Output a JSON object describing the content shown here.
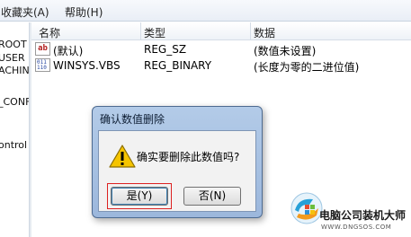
{
  "menubar": {
    "favorites": "收藏夹(A)",
    "help": "帮助(H)"
  },
  "tree": {
    "items": [
      "ROOT",
      "USER",
      "ACHIN",
      "_CONF",
      "ontrol"
    ]
  },
  "columns": {
    "name": "名称",
    "type": "类型",
    "data": "数据"
  },
  "rows": [
    {
      "icon": "string-value-icon",
      "icon_text": "ab",
      "name": "(默认)",
      "type": "REG_SZ",
      "data": "(数值未设置)"
    },
    {
      "icon": "binary-value-icon",
      "icon_text": "011 110",
      "name": "WINSYS.VBS",
      "type": "REG_BINARY",
      "data": "(长度为零的二进位值)"
    }
  ],
  "dialog": {
    "title": "确认数值删除",
    "message": "确实要删除此数值吗?",
    "yes_label": "是(Y)",
    "no_label": "否(N)",
    "icon": "warning-icon"
  },
  "watermark": {
    "title": "电脑公司装机大师",
    "url": "WWW.DNGSOS.COM"
  },
  "colors": {
    "dialog_frame": "#9cb7dc",
    "focus_ring": "#dd2222",
    "warning": "#f5c400"
  }
}
